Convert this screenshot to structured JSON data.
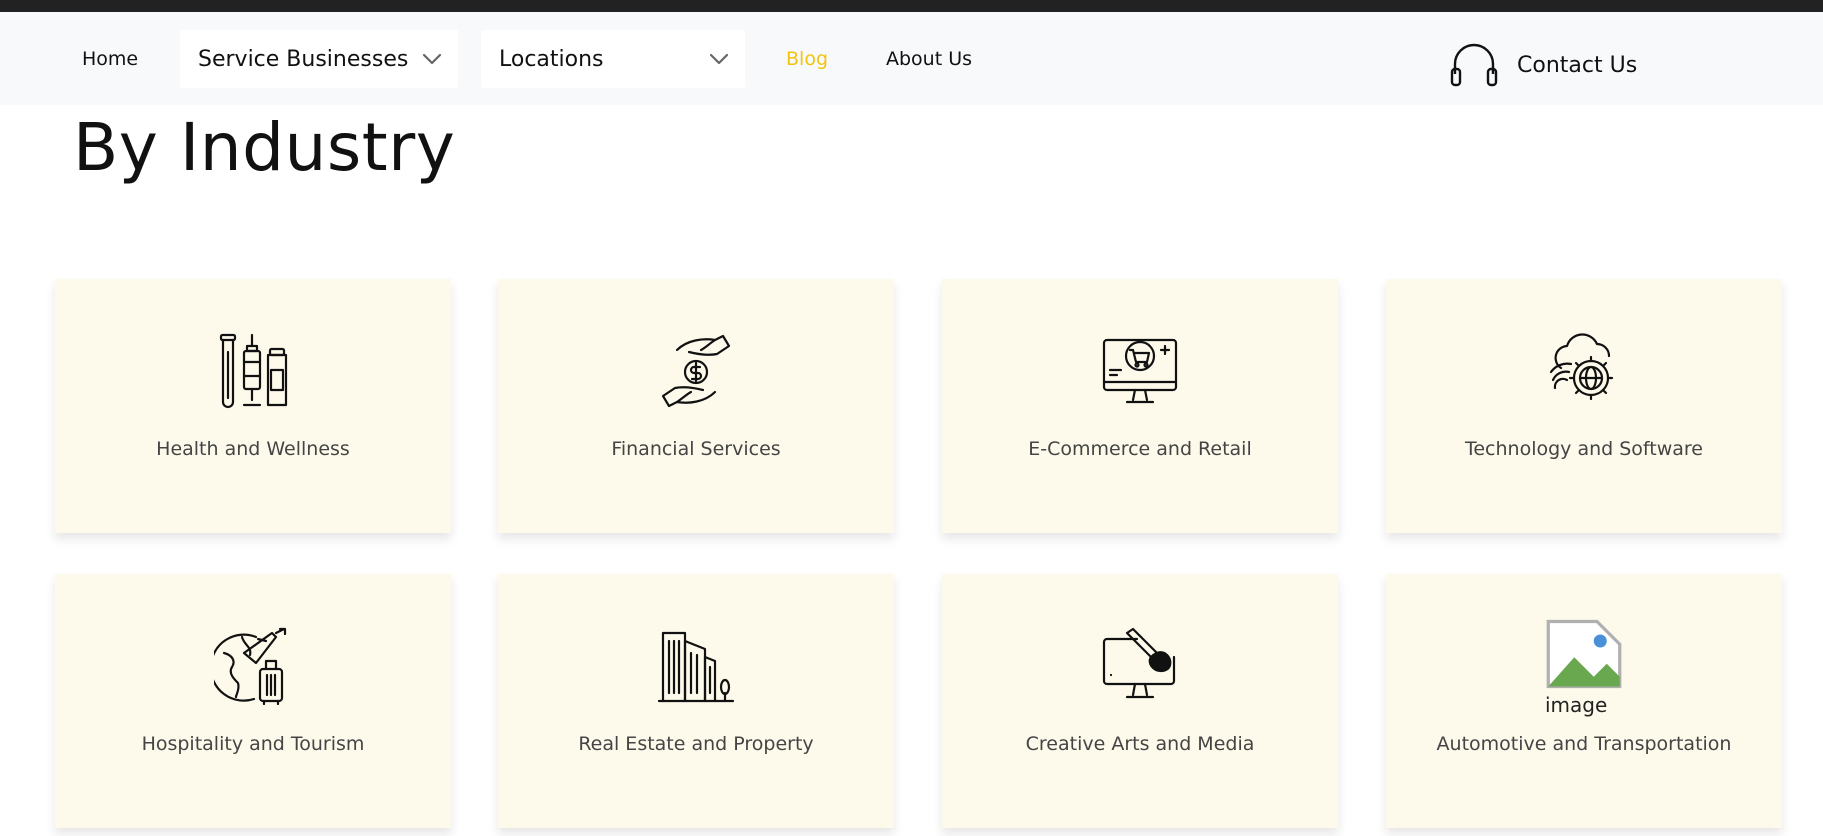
{
  "nav": {
    "home": "Home",
    "service_businesses": "Service Businesses",
    "locations": "Locations",
    "blog": "Blog",
    "about": "About Us",
    "contact": "Contact Us"
  },
  "page": {
    "title": "By Industry"
  },
  "industries": [
    {
      "label": "Health and Wellness",
      "icon": "health-icon"
    },
    {
      "label": "Financial Services",
      "icon": "finance-icon"
    },
    {
      "label": "E-Commerce and Retail",
      "icon": "ecommerce-icon"
    },
    {
      "label": "Technology and Software",
      "icon": "technology-icon"
    },
    {
      "label": "Hospitality and Tourism",
      "icon": "travel-icon"
    },
    {
      "label": "Real Estate and Property",
      "icon": "buildings-icon"
    },
    {
      "label": "Creative Arts and Media",
      "icon": "creative-icon"
    },
    {
      "label": "Automotive and Transportation",
      "icon": "broken-image-icon",
      "alt_text": "image"
    }
  ],
  "colors": {
    "top_strip": "#222222",
    "navbar_bg": "#f8f9fa",
    "blog_accent": "#f2c40f",
    "card_bg": "#fdfaeb"
  }
}
